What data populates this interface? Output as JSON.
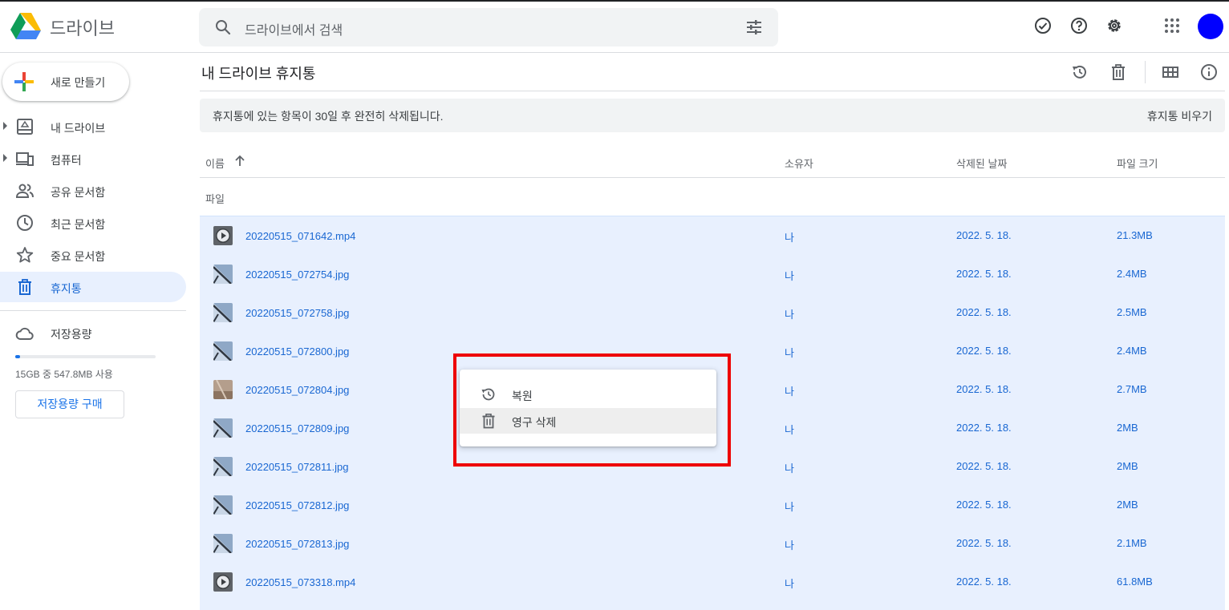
{
  "app": {
    "brand": "드라이브"
  },
  "search": {
    "placeholder": "드라이브에서 검색"
  },
  "sidebar": {
    "new_label": "새로 만들기",
    "items": [
      {
        "label": "내 드라이브",
        "icon": "my-drive-icon",
        "expandable": true
      },
      {
        "label": "컴퓨터",
        "icon": "computers-icon",
        "expandable": true
      },
      {
        "label": "공유 문서함",
        "icon": "shared-icon",
        "expandable": false
      },
      {
        "label": "최근 문서함",
        "icon": "clock-icon",
        "expandable": false
      },
      {
        "label": "중요 문서함",
        "icon": "star-icon",
        "expandable": false
      },
      {
        "label": "휴지통",
        "icon": "trash-icon",
        "expandable": false,
        "active": true
      }
    ],
    "storage_label": "저장용량",
    "storage_text": "15GB 중 547.8MB 사용",
    "storage_used_fraction": 0.036,
    "buy_label": "저장용량 구매"
  },
  "main": {
    "title": "내 드라이브 휴지통",
    "banner_msg": "휴지통에 있는 항목이 30일 후 완전히 삭제됩니다.",
    "empty_trash_label": "휴지통 비우기",
    "columns": {
      "name": "이름",
      "owner": "소유자",
      "deleted": "삭제된 날짜",
      "size": "파일 크기"
    },
    "section_label": "파일",
    "rows": [
      {
        "name": "20220515_071642.mp4",
        "owner": "나",
        "date": "2022. 5. 18.",
        "size": "21.3MB",
        "kind": "video"
      },
      {
        "name": "20220515_072754.jpg",
        "owner": "나",
        "date": "2022. 5. 18.",
        "size": "2.4MB",
        "kind": "image"
      },
      {
        "name": "20220515_072758.jpg",
        "owner": "나",
        "date": "2022. 5. 18.",
        "size": "2.5MB",
        "kind": "image"
      },
      {
        "name": "20220515_072800.jpg",
        "owner": "나",
        "date": "2022. 5. 18.",
        "size": "2.4MB",
        "kind": "image"
      },
      {
        "name": "20220515_072804.jpg",
        "owner": "나",
        "date": "2022. 5. 18.",
        "size": "2.7MB",
        "kind": "image-warm"
      },
      {
        "name": "20220515_072809.jpg",
        "owner": "나",
        "date": "2022. 5. 18.",
        "size": "2MB",
        "kind": "image"
      },
      {
        "name": "20220515_072811.jpg",
        "owner": "나",
        "date": "2022. 5. 18.",
        "size": "2MB",
        "kind": "image"
      },
      {
        "name": "20220515_072812.jpg",
        "owner": "나",
        "date": "2022. 5. 18.",
        "size": "2MB",
        "kind": "image"
      },
      {
        "name": "20220515_072813.jpg",
        "owner": "나",
        "date": "2022. 5. 18.",
        "size": "2.1MB",
        "kind": "image"
      },
      {
        "name": "20220515_073318.mp4",
        "owner": "나",
        "date": "2022. 5. 18.",
        "size": "61.8MB",
        "kind": "video"
      }
    ]
  },
  "context_menu": {
    "items": [
      {
        "label": "복원",
        "icon": "restore-icon"
      },
      {
        "label": "영구 삭제",
        "icon": "trash-icon",
        "hovered": true
      }
    ]
  },
  "colors": {
    "accent": "#1a73e8",
    "selection": "#e8f0fe",
    "highlight_box": "#ee0000",
    "avatar": "#0000ff"
  }
}
